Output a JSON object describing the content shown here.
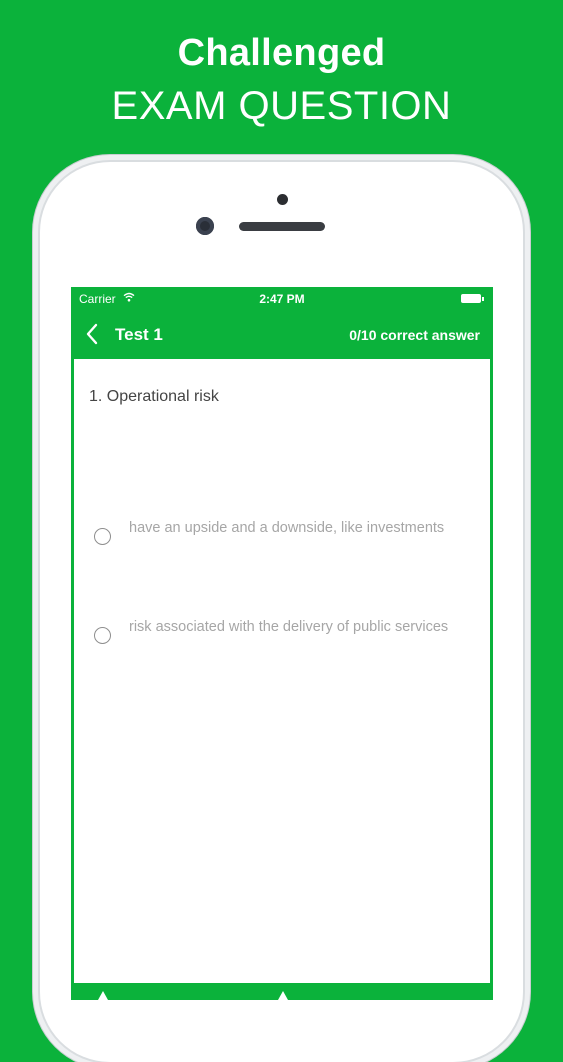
{
  "promo": {
    "line1": "Challenged",
    "line2": "EXAM QUESTION"
  },
  "status_bar": {
    "carrier": "Carrier",
    "time": "2:47 PM"
  },
  "nav": {
    "title": "Test 1",
    "score": "0/10 correct answer"
  },
  "question": {
    "text": "1. Operational risk"
  },
  "options": [
    {
      "label": "have an upside and a downside, like investments",
      "selected": false
    },
    {
      "label": "risk associated with the delivery of public services",
      "selected": false
    }
  ],
  "colors": {
    "accent": "#0bb23b",
    "option_text": "#a6a6a6",
    "question_text": "#444444"
  },
  "icons": [
    "wifi-icon",
    "battery-icon",
    "back-chevron-icon",
    "radio-icon"
  ]
}
